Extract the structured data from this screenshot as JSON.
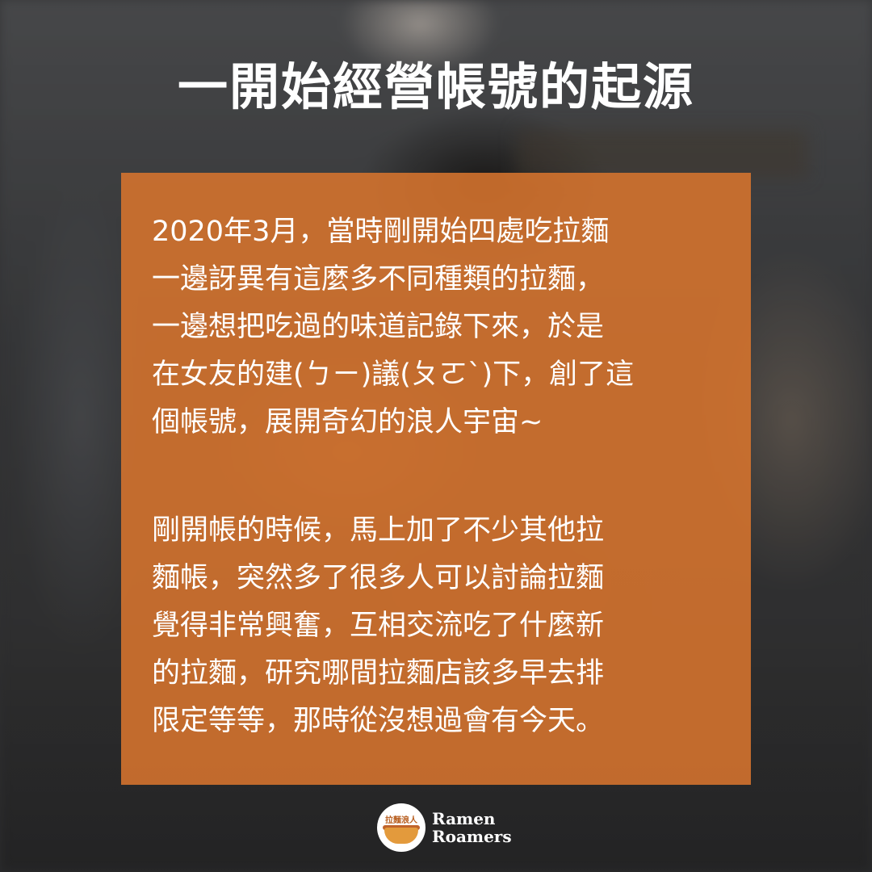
{
  "title": "一開始經營帳號的起源",
  "paragraphs": [
    {
      "lines": [
        "2020年3月，當時剛開始四處吃拉麵",
        "一邊訝異有這麼多不同種類的拉麵，",
        "一邊想把吃過的味道記錄下來，於是",
        "在女友的建(ㄅㄧ)議(ㄆㄛˋ)下，創了這",
        "個帳號，展開奇幻的浪人宇宙~"
      ]
    },
    {
      "lines": [
        "剛開帳的時候，馬上加了不少其他拉",
        "麵帳，突然多了很多人可以討論拉麵",
        "覺得非常興奮，互相交流吃了什麼新",
        "的拉麵，研究哪間拉麵店該多早去排",
        "限定等等，那時從沒想過會有今天。"
      ]
    }
  ],
  "brand": {
    "logo_text": "拉麵浪人",
    "name_line1": "Ramen",
    "name_line2": "Roamers"
  },
  "colors": {
    "panel": "#d7742e",
    "text": "#ffffff",
    "background": "#3a3b3d"
  }
}
